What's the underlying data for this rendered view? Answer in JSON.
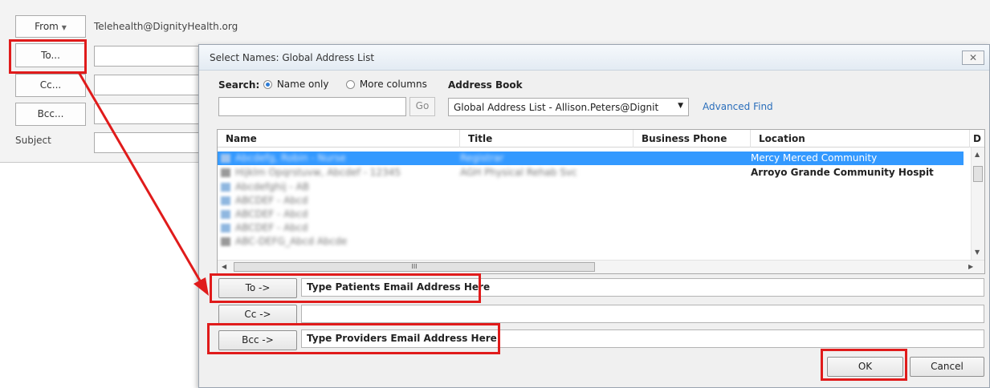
{
  "compose": {
    "from_label": "From",
    "from_address": "Telehealth@DignityHealth.org",
    "to_label": "To...",
    "cc_label": "Cc...",
    "bcc_label": "Bcc...",
    "subject_label": "Subject"
  },
  "dialog": {
    "title": "Select Names: Global Address List",
    "search_label": "Search:",
    "radio_name_only": "Name only",
    "radio_more_columns": "More columns",
    "address_book_label": "Address Book",
    "go_label": "Go",
    "address_book_value": "Global Address List - Allison.Peters@Dignit",
    "advanced_find": "Advanced Find",
    "columns": [
      "Name",
      "Title",
      "Business Phone",
      "Location",
      "D"
    ],
    "rows": [
      {
        "name": "Abcdefg, Robin - Nurse",
        "title": "Registrar",
        "phone": "",
        "location": "Mercy Merced Community",
        "selected": true
      },
      {
        "name": "Hijklm Opqrstuvw, Abcdef - 12345",
        "title": "AGH Physical Rehab Svc",
        "phone": "",
        "location": "Arroyo Grande Community Hospit",
        "selected": false
      },
      {
        "name": "Abcdefghij - AB",
        "title": "",
        "phone": "",
        "location": "",
        "selected": false
      },
      {
        "name": "ABCDEF - Abcd",
        "title": "",
        "phone": "",
        "location": "",
        "selected": false
      },
      {
        "name": "ABCDEF - Abcd",
        "title": "",
        "phone": "",
        "location": "",
        "selected": false
      },
      {
        "name": "ABCDEF - Abcd",
        "title": "",
        "phone": "",
        "location": "",
        "selected": false
      },
      {
        "name": "ABC-DEFG_Abcd Abcde",
        "title": "",
        "phone": "",
        "location": "",
        "selected": false
      }
    ],
    "hscroll_grip": "III",
    "to_button": "To ->",
    "to_value": "Type Patients Email Address Here",
    "cc_button": "Cc ->",
    "cc_value": "",
    "bcc_button": "Bcc ->",
    "bcc_value": "Type Providers Email Address Here",
    "ok_button": "OK",
    "cancel_button": "Cancel"
  },
  "colors": {
    "annotation_red": "#e01b1b",
    "selection_blue": "#3399ff",
    "link_blue": "#2a6ebb"
  },
  "icons": [
    "chevron-down-icon",
    "close-icon",
    "scroll-up-icon",
    "scroll-down-icon",
    "scroll-left-icon",
    "scroll-right-icon",
    "annotation-arrow"
  ]
}
